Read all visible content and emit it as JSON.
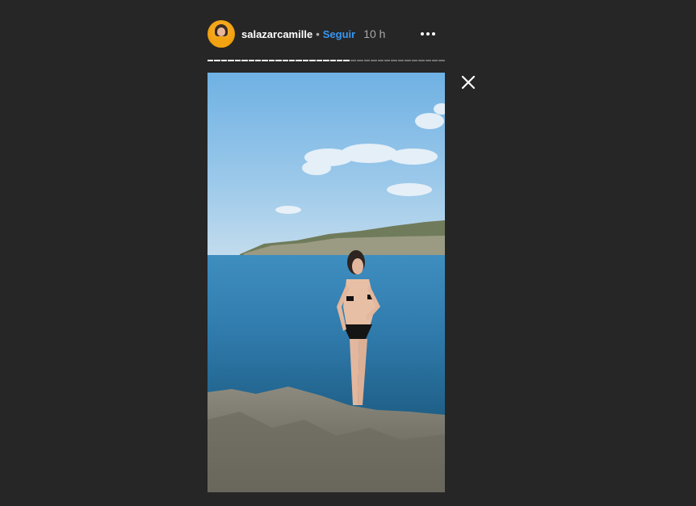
{
  "story": {
    "username": "salazarcamille",
    "separator": "•",
    "follow_label": "Seguir",
    "time_ago": "10 h",
    "progress": {
      "segments": 35,
      "completed": 21
    }
  },
  "icons": {
    "more": "more-options-icon",
    "close": "close-icon"
  },
  "colors": {
    "background": "#262626",
    "follow": "#3897f0",
    "text": "#ffffff",
    "muted": "#a8a8a8"
  }
}
